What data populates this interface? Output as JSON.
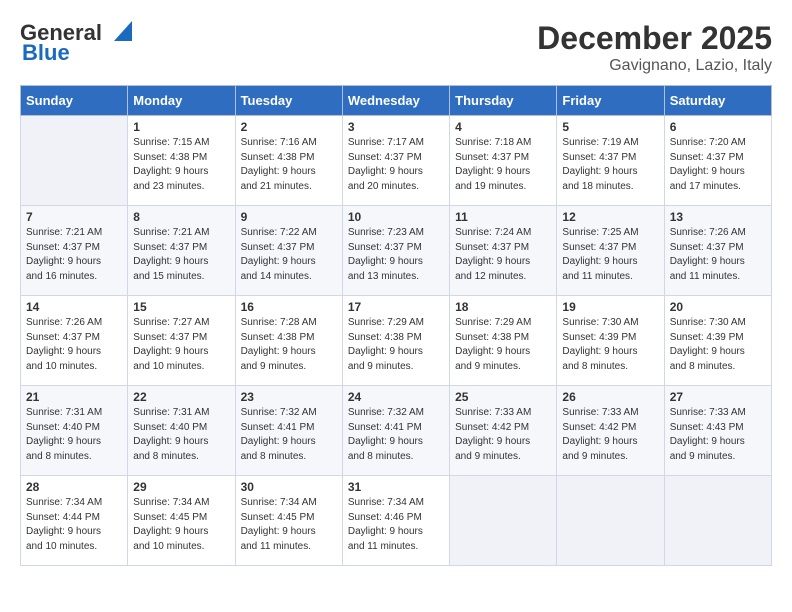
{
  "logo": {
    "line1": "General",
    "line2": "Blue"
  },
  "title": "December 2025",
  "subtitle": "Gavignano, Lazio, Italy",
  "days_header": [
    "Sunday",
    "Monday",
    "Tuesday",
    "Wednesday",
    "Thursday",
    "Friday",
    "Saturday"
  ],
  "weeks": [
    [
      {
        "num": "",
        "info": ""
      },
      {
        "num": "1",
        "info": "Sunrise: 7:15 AM\nSunset: 4:38 PM\nDaylight: 9 hours\nand 23 minutes."
      },
      {
        "num": "2",
        "info": "Sunrise: 7:16 AM\nSunset: 4:38 PM\nDaylight: 9 hours\nand 21 minutes."
      },
      {
        "num": "3",
        "info": "Sunrise: 7:17 AM\nSunset: 4:37 PM\nDaylight: 9 hours\nand 20 minutes."
      },
      {
        "num": "4",
        "info": "Sunrise: 7:18 AM\nSunset: 4:37 PM\nDaylight: 9 hours\nand 19 minutes."
      },
      {
        "num": "5",
        "info": "Sunrise: 7:19 AM\nSunset: 4:37 PM\nDaylight: 9 hours\nand 18 minutes."
      },
      {
        "num": "6",
        "info": "Sunrise: 7:20 AM\nSunset: 4:37 PM\nDaylight: 9 hours\nand 17 minutes."
      }
    ],
    [
      {
        "num": "7",
        "info": "Sunrise: 7:21 AM\nSunset: 4:37 PM\nDaylight: 9 hours\nand 16 minutes."
      },
      {
        "num": "8",
        "info": "Sunrise: 7:21 AM\nSunset: 4:37 PM\nDaylight: 9 hours\nand 15 minutes."
      },
      {
        "num": "9",
        "info": "Sunrise: 7:22 AM\nSunset: 4:37 PM\nDaylight: 9 hours\nand 14 minutes."
      },
      {
        "num": "10",
        "info": "Sunrise: 7:23 AM\nSunset: 4:37 PM\nDaylight: 9 hours\nand 13 minutes."
      },
      {
        "num": "11",
        "info": "Sunrise: 7:24 AM\nSunset: 4:37 PM\nDaylight: 9 hours\nand 12 minutes."
      },
      {
        "num": "12",
        "info": "Sunrise: 7:25 AM\nSunset: 4:37 PM\nDaylight: 9 hours\nand 11 minutes."
      },
      {
        "num": "13",
        "info": "Sunrise: 7:26 AM\nSunset: 4:37 PM\nDaylight: 9 hours\nand 11 minutes."
      }
    ],
    [
      {
        "num": "14",
        "info": "Sunrise: 7:26 AM\nSunset: 4:37 PM\nDaylight: 9 hours\nand 10 minutes."
      },
      {
        "num": "15",
        "info": "Sunrise: 7:27 AM\nSunset: 4:37 PM\nDaylight: 9 hours\nand 10 minutes."
      },
      {
        "num": "16",
        "info": "Sunrise: 7:28 AM\nSunset: 4:38 PM\nDaylight: 9 hours\nand 9 minutes."
      },
      {
        "num": "17",
        "info": "Sunrise: 7:29 AM\nSunset: 4:38 PM\nDaylight: 9 hours\nand 9 minutes."
      },
      {
        "num": "18",
        "info": "Sunrise: 7:29 AM\nSunset: 4:38 PM\nDaylight: 9 hours\nand 9 minutes."
      },
      {
        "num": "19",
        "info": "Sunrise: 7:30 AM\nSunset: 4:39 PM\nDaylight: 9 hours\nand 8 minutes."
      },
      {
        "num": "20",
        "info": "Sunrise: 7:30 AM\nSunset: 4:39 PM\nDaylight: 9 hours\nand 8 minutes."
      }
    ],
    [
      {
        "num": "21",
        "info": "Sunrise: 7:31 AM\nSunset: 4:40 PM\nDaylight: 9 hours\nand 8 minutes."
      },
      {
        "num": "22",
        "info": "Sunrise: 7:31 AM\nSunset: 4:40 PM\nDaylight: 9 hours\nand 8 minutes."
      },
      {
        "num": "23",
        "info": "Sunrise: 7:32 AM\nSunset: 4:41 PM\nDaylight: 9 hours\nand 8 minutes."
      },
      {
        "num": "24",
        "info": "Sunrise: 7:32 AM\nSunset: 4:41 PM\nDaylight: 9 hours\nand 8 minutes."
      },
      {
        "num": "25",
        "info": "Sunrise: 7:33 AM\nSunset: 4:42 PM\nDaylight: 9 hours\nand 9 minutes."
      },
      {
        "num": "26",
        "info": "Sunrise: 7:33 AM\nSunset: 4:42 PM\nDaylight: 9 hours\nand 9 minutes."
      },
      {
        "num": "27",
        "info": "Sunrise: 7:33 AM\nSunset: 4:43 PM\nDaylight: 9 hours\nand 9 minutes."
      }
    ],
    [
      {
        "num": "28",
        "info": "Sunrise: 7:34 AM\nSunset: 4:44 PM\nDaylight: 9 hours\nand 10 minutes."
      },
      {
        "num": "29",
        "info": "Sunrise: 7:34 AM\nSunset: 4:45 PM\nDaylight: 9 hours\nand 10 minutes."
      },
      {
        "num": "30",
        "info": "Sunrise: 7:34 AM\nSunset: 4:45 PM\nDaylight: 9 hours\nand 11 minutes."
      },
      {
        "num": "31",
        "info": "Sunrise: 7:34 AM\nSunset: 4:46 PM\nDaylight: 9 hours\nand 11 minutes."
      },
      {
        "num": "",
        "info": ""
      },
      {
        "num": "",
        "info": ""
      },
      {
        "num": "",
        "info": ""
      }
    ]
  ]
}
